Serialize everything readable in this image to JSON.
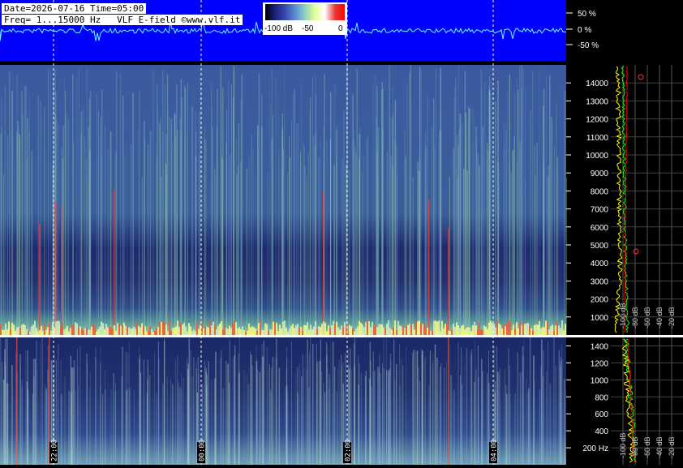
{
  "header": {
    "date_line": "Date=2026-07-16 Time=05:00",
    "freq_line": "Freq= 1...15000 Hz   VLF E-field ©www.vlf.it"
  },
  "colorbar": {
    "labels": [
      "-100 dB",
      "-50",
      "0"
    ],
    "stops": [
      "#000000",
      "#1a237e",
      "#3949ab",
      "#5c8fd6",
      "#8fd0c0",
      "#e8ff9a",
      "#ffffff",
      "#e53935",
      "#ff0000"
    ]
  },
  "waveform": {
    "labels": [
      "50 %",
      "0 %",
      "-50 %"
    ],
    "background": "#0000ff"
  },
  "chart_data": [
    {
      "type": "heatmap",
      "name": "spectrogram-full",
      "y_unit": "Hz",
      "y_ticks": [
        1000,
        2000,
        3000,
        4000,
        5000,
        6000,
        7000,
        8000,
        9000,
        10000,
        11000,
        12000,
        13000,
        14000
      ],
      "ylim": [
        0,
        15000
      ],
      "time_labels": [
        "22:00",
        "00:00",
        "02:00",
        "04:00"
      ]
    },
    {
      "type": "heatmap",
      "name": "spectrogram-low",
      "y_unit": "Hz",
      "y_ticks": [
        200,
        400,
        600,
        800,
        1000,
        1200,
        1400
      ],
      "y_tick_labels": [
        "200 Hz",
        "400",
        "600",
        "800",
        "1000",
        "1200",
        "1400"
      ],
      "ylim": [
        0,
        1500
      ]
    },
    {
      "type": "line",
      "name": "spectrum-profile",
      "x_tick_labels": [
        "-100 dB",
        "-80 dB",
        "-60 dB",
        "-40 dB",
        "-20 dB"
      ],
      "series_colors": [
        "#ffff00",
        "#00ff00",
        "#ff0000"
      ]
    }
  ],
  "colors": {
    "spectro_bg": "#2c3f86",
    "band_low": "#1d2a6a",
    "marker": "#ff3333"
  }
}
